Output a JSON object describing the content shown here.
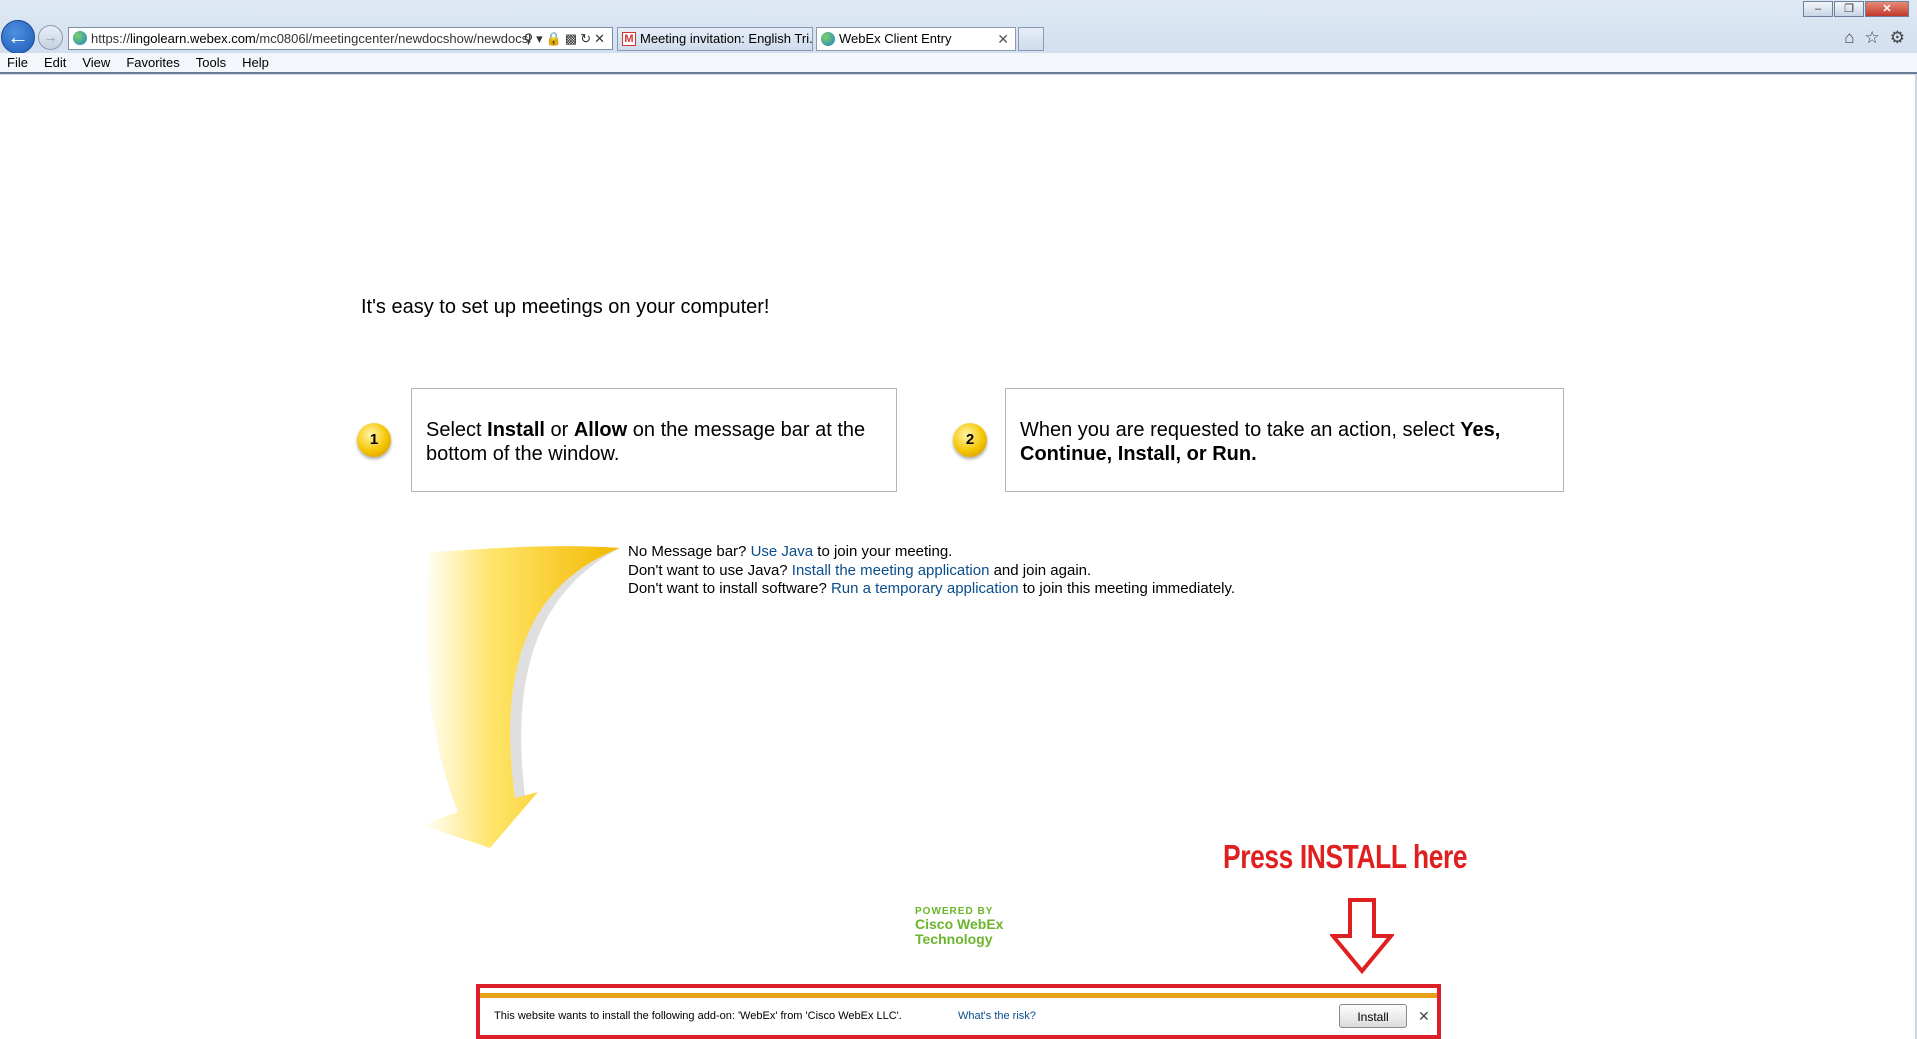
{
  "browser": {
    "address": {
      "prefix": "https://",
      "host": "lingolearn.webex.com",
      "path": "/mc0806l/meetingcenter/newdocshow/newdocsl"
    },
    "tabs": [
      {
        "label": "Meeting invitation: English Tri..."
      },
      {
        "label": "WebEx Client Entry"
      }
    ],
    "menu": [
      "File",
      "Edit",
      "View",
      "Favorites",
      "Tools",
      "Help"
    ]
  },
  "page": {
    "headline": "It's easy to set up meetings on your computer!",
    "step1": {
      "number": "1",
      "t1": "Select ",
      "b1": "Install",
      "t2": " or ",
      "b2": "Allow",
      "t3": " on the message bar at the bottom of the window."
    },
    "step2": {
      "number": "2",
      "t1": "When you are requested to take an action, select ",
      "b1": "Yes, Continue, Install, or Run."
    },
    "help": [
      {
        "pre": "No Message bar? ",
        "link": "Use Java",
        "post": " to join your meeting."
      },
      {
        "pre": "Don't want to use Java? ",
        "link": "Install the meeting application",
        "post": " and join again."
      },
      {
        "pre": "Don't want to install software? ",
        "link": "Run a temporary application",
        "post": " to join this meeting immediately."
      }
    ],
    "powered": {
      "line1": "POWERED BY",
      "line2": "Cisco WebEx",
      "line3": "Technology"
    },
    "annotation": "Press INSTALL here"
  },
  "notification": {
    "message": "This website wants to install the following add-on: 'WebEx' from 'Cisco WebEx LLC'.",
    "risk_link": "What's the risk?",
    "install_label": "Install"
  },
  "colors": {
    "link": "#0b4d8c",
    "annotation_red": "#e02020",
    "cisco_green": "#6bb52b",
    "notify_stripe": "#e8a21a"
  }
}
